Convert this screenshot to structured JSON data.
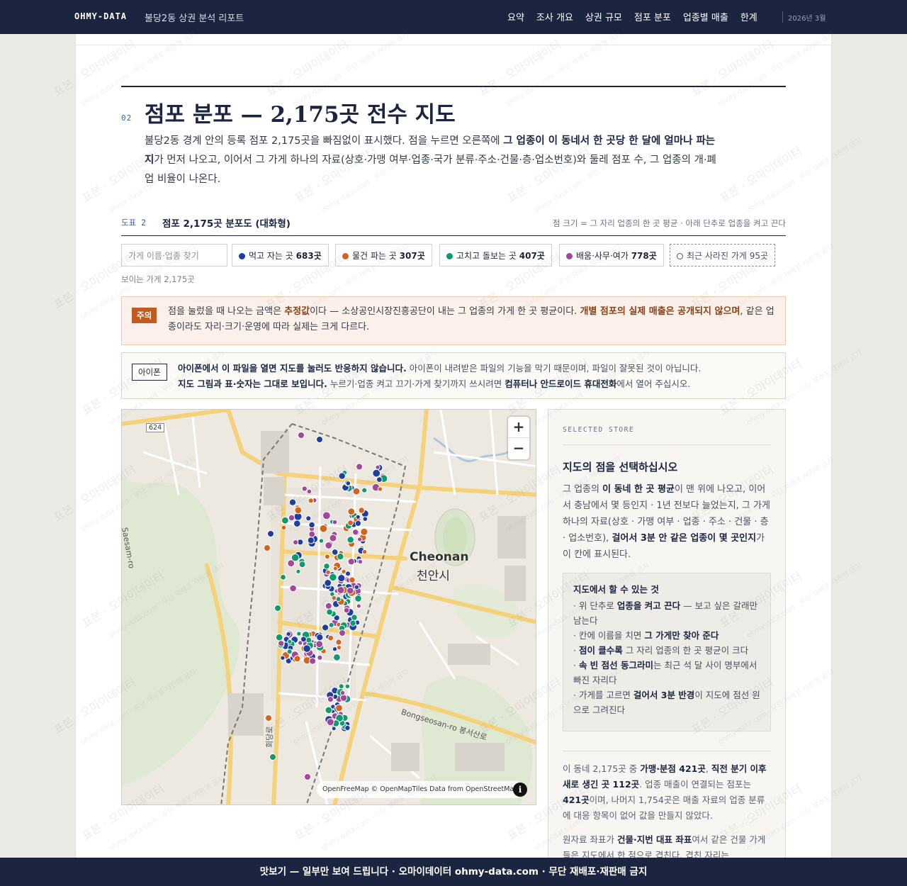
{
  "topbar": {
    "brand": "OHMY-DATA",
    "doc_title": "불당2동 상권 분석 리포트",
    "nav": [
      "요약",
      "조사 개요",
      "상권 규모",
      "점포 분포",
      "업종별 매출",
      "한계"
    ],
    "date": "2026년 3월"
  },
  "section": {
    "number": "02",
    "title": "점포 분포 — 2,175곳 전수 지도",
    "intro_1": "불당2동 경계 안의 등록 점포 2,175곳을 빠짐없이 표시했다. 점을 누르면 오른쪽에 ",
    "intro_bold": "그 업종이 이 동네서 한 곳당 한 달에 얼마나 파는지",
    "intro_2": "가 먼저 나오고, 이어서 그 가게 하나의 자료(상호·가맹 여부·업종·국가 분류·주소·건물·층·업소번호)와 둘레 점포 수, 그 업종의 개·폐업 비율이 나온다."
  },
  "figure": {
    "tag": "도표 2",
    "title": "점포 2,175곳 분포도 (대화형)",
    "note": "점 크기 = 그 자리 업종의 한 곳 평균 · 아래 단추로 업종을 켜고 끈다"
  },
  "filters": {
    "search_placeholder": "가게 이름·업종 찾기",
    "chips": [
      {
        "label": "먹고 자는 곳",
        "count": "683곳",
        "color": "#1f3fa0"
      },
      {
        "label": "물건 파는 곳",
        "count": "307곳",
        "color": "#d2641c"
      },
      {
        "label": "고치고 돌보는 곳",
        "count": "407곳",
        "color": "#0e9a6c"
      },
      {
        "label": "배움·사무·여가",
        "count": "778곳",
        "color": "#a0489a"
      },
      {
        "label": "최근 사라진 가게",
        "count": "95곳",
        "color": "#ffffff"
      }
    ],
    "visible_count": "보이는 가게 2,175곳"
  },
  "warning": {
    "badge": "주의",
    "t1": "점을 눌렀을 때 나오는 금액은 ",
    "b1": "추정값",
    "t2": "이다 — 소상공인시장진흥공단이 내는 그 업종의 가게 한 곳 평균이다. ",
    "b2": "개별 점포의 실제 매출은 공개되지 않으며",
    "t3": ", 같은 업종이라도 자리·크기·운영에 따라 실제는 크게 다르다."
  },
  "ios_notice": {
    "badge": "아이폰",
    "b1": "아이폰에서 이 파일을 열면 지도를 눌러도 반응하지 않습니다.",
    "t1": " 아이폰이 내려받은 파일의 기능을 막기 때문이며, 파일이 잘못된 것이 아닙니다. ",
    "b2": "지도 그림과 표·숫자는 그대로 보입니다.",
    "t2": " 누르기·업종 켜고 끄기·가게 찾기까지 쓰시려면 ",
    "b3": "컴퓨터나 안드로이드 휴대전화",
    "t3": "에서 열어 주십시오."
  },
  "map": {
    "city_en": "Cheonan",
    "city_ko": "천안시",
    "road_624": "624",
    "road_bongseo": "Bongseosan-ro 봉서산로",
    "road_saesam": "Saesam-ro",
    "road_hoedang": "회당로",
    "zoom_in": "+",
    "zoom_out": "−",
    "attribution": "OpenFreeMap © OpenMapTiles Data from OpenStreetMap",
    "info": "i"
  },
  "panel": {
    "eyebrow": "SELECTED STORE",
    "title": "지도의 점을 선택하십시오",
    "d1": "그 업종의 ",
    "d1b": "이 동네 한 곳 평균",
    "d2": "이 맨 위에 나오고, 이어서 충남에서 몇 등인지 · 1년 전보다 늘었는지, 그 가게 하나의 자료(상호 · 가맹 여부 · 업종 · 주소 · 건물 · 층 · 업소번호), ",
    "d2b": "걸어서 3분 안 같은 업종이 몇 곳인지",
    "d3": "가 이 칸에 표시된다.",
    "howto_title": "지도에서 할 수 있는 것",
    "howto": [
      {
        "pre": "· 위 단추로 ",
        "b": "업종을 켜고 끈다",
        "post": " — 보고 싶은 갈래만 남는다"
      },
      {
        "pre": "· 칸에 이름을 치면 ",
        "b": "그 가게만 찾아 준다",
        "post": ""
      },
      {
        "pre": "· ",
        "b": "점이 클수록",
        "post": " 그 자리 업종의 한 곳 평균이 크다"
      },
      {
        "pre": "· ",
        "b": "속 빈 점선 동그라미",
        "post": "는 최근 석 달 사이 명부에서 빠진 자리다"
      },
      {
        "pre": "· 가게를 고르면 ",
        "b": "걸어서 3분 반경",
        "post": "이 지도에 점선 원으로 그려진다"
      }
    ],
    "s1": "이 동네 2,175곳 중 ",
    "s1b": "가맹·분점 421곳",
    "s2": ", ",
    "s2b": "직전 분기 이후 새로 생긴 곳 112곳",
    "s3": ". 업종 매출이 연결되는 점포는 ",
    "s3b": "421곳",
    "s4": "이며, 나머지 1,754곳은 매출 자료의 업종 분류에 대응 항목이 없어 값을 만들지 않았다.",
    "src1": "원자료 좌표가 ",
    "src1b": "건물·지번 대표 좌표",
    "src2": "여서 같은 건물 가게들은 지도에서 한 점으로 겹친다. 겹친 자리는"
  },
  "footer": {
    "text": "맛보기 — 일부만 보여 드립니다 · 오마이데이터 ohmy-data.com · 무단 재배포·재판매 금지"
  },
  "watermark": {
    "line1": "표본 · 오마이데이터",
    "line2": "ohmy-data.com · 무단 재배포·재판매 금지"
  }
}
